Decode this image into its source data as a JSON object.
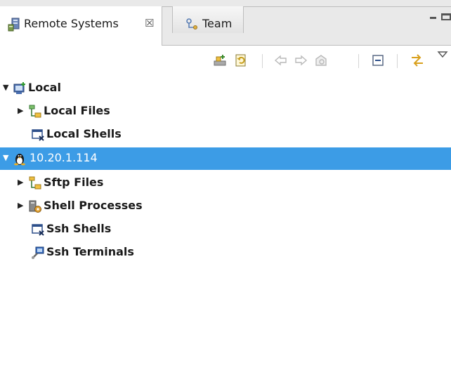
{
  "tabs": [
    {
      "label": "Remote Systems",
      "close": "☒",
      "active": true
    },
    {
      "label": "Team",
      "active": false
    }
  ],
  "toolbar": {
    "buttons": [
      "new-connection-icon",
      "refresh-icon",
      "back-icon",
      "forward-icon",
      "home-icon",
      "collapse-all-icon",
      "link-with-editor-icon",
      "view-menu-icon"
    ]
  },
  "tree": [
    {
      "label": "Local",
      "expanded": true,
      "level": 0,
      "icon": "local-host-icon"
    },
    {
      "label": "Local Files",
      "expanded": false,
      "level": 1,
      "icon": "files-icon"
    },
    {
      "label": "Local Shells",
      "level": 1,
      "icon": "shells-icon"
    },
    {
      "label": "10.20.1.114",
      "expanded": true,
      "level": 0,
      "icon": "linux-icon",
      "selected": true
    },
    {
      "label": "Sftp Files",
      "expanded": false,
      "level": 1,
      "icon": "files-icon"
    },
    {
      "label": "Shell Processes",
      "expanded": false,
      "level": 1,
      "icon": "processes-icon"
    },
    {
      "label": "Ssh Shells",
      "level": 1,
      "icon": "shells-icon"
    },
    {
      "label": "Ssh Terminals",
      "level": 1,
      "icon": "terminal-icon"
    }
  ],
  "colors": {
    "selection": "#3c9ce6",
    "tab_bg": "#e9e9e9"
  }
}
